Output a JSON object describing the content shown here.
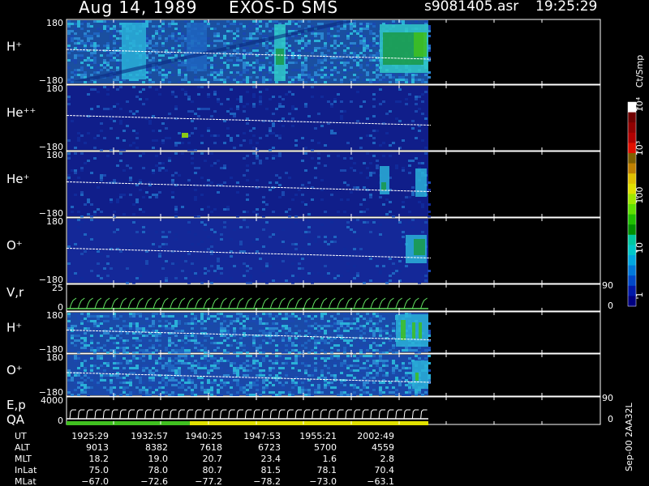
{
  "header": {
    "date": "Aug 14, 1989",
    "instrument": "EXOS-D SMS",
    "file": "s9081405.asr",
    "time": "19:25:29"
  },
  "colorbar": {
    "unit_label": "Ct/Smp",
    "tick_labels": [
      "1",
      "10",
      "100",
      "10³",
      "10⁴"
    ],
    "colors": [
      "#000080",
      "#0018a8",
      "#0048c8",
      "#0078d8",
      "#00a8e0",
      "#00c8c8",
      "#00c8a0",
      "#009000",
      "#20c000",
      "#60e000",
      "#a0e800",
      "#e0e000",
      "#e0c000",
      "#c08000",
      "#806000",
      "#e01000",
      "#b00000",
      "#900000",
      "#700000",
      "#ffffff"
    ]
  },
  "panels": [
    {
      "id": "h-plus-1",
      "label": "H⁺",
      "ytick_top": "180",
      "ytick_bottom": "−180"
    },
    {
      "id": "he-plus-plus",
      "label": "He⁺⁺",
      "ytick_top": "180",
      "ytick_bottom": "−180"
    },
    {
      "id": "he-plus",
      "label": "He⁺",
      "ytick_top": "180",
      "ytick_bottom": "−180"
    },
    {
      "id": "o-plus-1",
      "label": "O⁺",
      "ytick_top": "180",
      "ytick_bottom": "−180"
    },
    {
      "id": "vr",
      "label": "V,r",
      "ytick_top": "25",
      "ytick_bottom": "0",
      "right_top": "90",
      "right_bottom": "0"
    },
    {
      "id": "h-plus-2",
      "label": "H⁺",
      "ytick_top": "180",
      "ytick_bottom": "−180"
    },
    {
      "id": "o-plus-2",
      "label": "O⁺",
      "ytick_top": "180",
      "ytick_bottom": "−180"
    },
    {
      "id": "ep-qa",
      "label": "E,p",
      "label2": "QA",
      "ytick_top": "4000",
      "ytick_bottom": "0",
      "right_top": "90",
      "right_bottom": "0"
    }
  ],
  "footer": {
    "row_labels": [
      "UT",
      "ALT",
      "MLT",
      "InLat",
      "MLat"
    ],
    "columns": [
      [
        "1925:29",
        "9013",
        "18.2",
        "75.0",
        "−67.0"
      ],
      [
        "1932:57",
        "8382",
        "19.0",
        "78.0",
        "−72.6"
      ],
      [
        "1940:25",
        "7618",
        "20.7",
        "80.7",
        "−77.2"
      ],
      [
        "1947:53",
        "6723",
        "23.4",
        "81.5",
        "−78.2"
      ],
      [
        "1955:21",
        "5700",
        "1.6",
        "78.1",
        "−73.0"
      ],
      [
        "2002:49",
        "4559",
        "2.8",
        "70.4",
        "−63.1"
      ]
    ],
    "side_note": "Sep-00 2AA32L"
  },
  "chart_data": {
    "type": "heatmap",
    "title": "Aug 14, 1989   EXOS-D SMS",
    "x_ticks_ut": [
      "1925:29",
      "1932:57",
      "1940:25",
      "1947:53",
      "1955:21",
      "2002:49"
    ],
    "pitch_angle_ylim": [
      -180,
      180
    ],
    "colorbar_scale": "log",
    "colorbar_range": [
      1,
      10000
    ],
    "series": [
      {
        "name": "H⁺",
        "type": "heatmap"
      },
      {
        "name": "He⁺⁺",
        "type": "heatmap"
      },
      {
        "name": "He⁺",
        "type": "heatmap"
      },
      {
        "name": "O⁺",
        "type": "heatmap"
      },
      {
        "name": "V,r",
        "type": "line"
      },
      {
        "name": "H⁺",
        "type": "heatmap"
      },
      {
        "name": "O⁺",
        "type": "heatmap"
      },
      {
        "name": "E,p",
        "type": "line"
      }
    ],
    "data_end_ut": "2005:35"
  }
}
